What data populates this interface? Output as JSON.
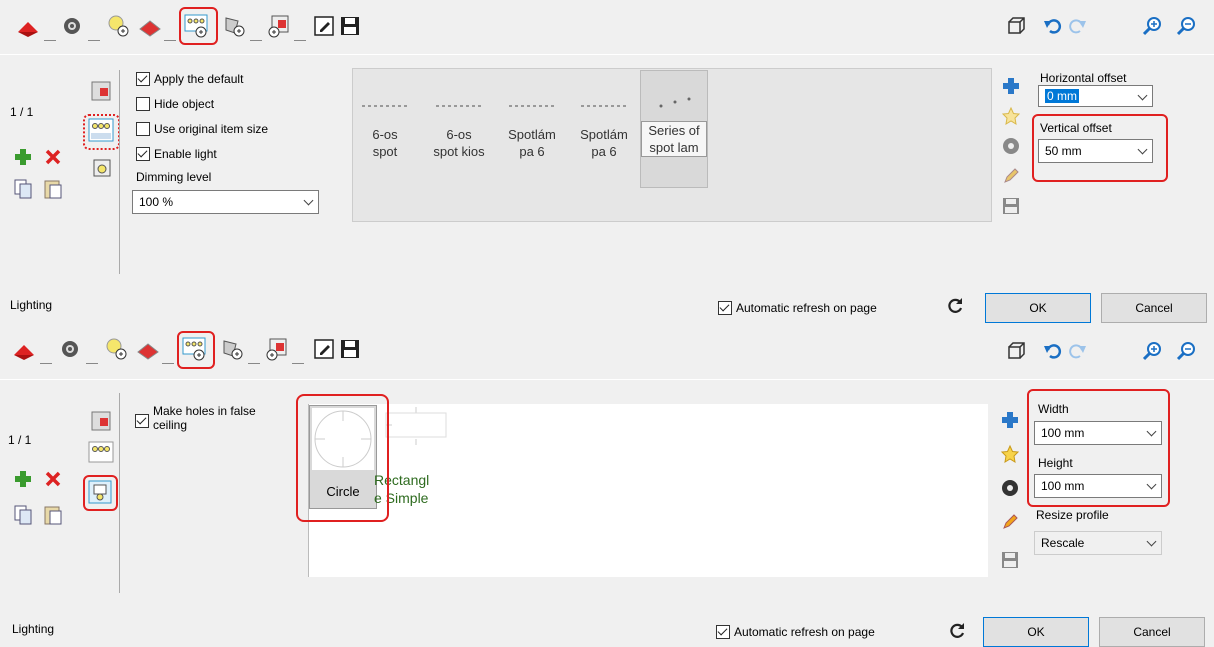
{
  "panel1": {
    "toolbar_icons": [
      "roof-icon",
      "gear-icon",
      "bulb-add-icon",
      "roof-shape-icon",
      "lights-add-icon",
      "lamp-add-icon",
      "block-add-icon",
      "edit-doc-icon",
      "save-icon"
    ],
    "counter": "1 / 1",
    "checkboxes": [
      {
        "label": "Apply the default",
        "checked": true
      },
      {
        "label": "Hide object",
        "checked": false
      },
      {
        "label": "Use original item size",
        "checked": false
      },
      {
        "label": "Enable light",
        "checked": true
      }
    ],
    "dimming_label": "Dimming level",
    "dimming_value": "100 %",
    "catalog": [
      {
        "line1": "6-os",
        "line2": "spot"
      },
      {
        "line1": "6-os",
        "line2": "spot kios"
      },
      {
        "line1": "Spotlám",
        "line2": "pa 6"
      },
      {
        "line1": "Spotlám",
        "line2": "pa 6"
      },
      {
        "line1": "Series of",
        "line2": "spot lam"
      }
    ],
    "horizontal_offset_label": "Horizontal offset",
    "horizontal_offset_value": "0 mm",
    "vertical_offset_label": "Vertical offset",
    "vertical_offset_value": "50 mm",
    "title": "Lighting",
    "auto_refresh_label": "Automatic refresh on page",
    "ok_label": "OK",
    "cancel_label": "Cancel"
  },
  "panel2": {
    "counter": "1 / 1",
    "make_holes_label": "Make holes in false ceiling",
    "circle_label": "Circle",
    "rect_line1": "Rectangl",
    "rect_line2": "e Simple",
    "width_label": "Width",
    "width_value": "100 mm",
    "height_label": "Height",
    "height_value": "100 mm",
    "resize_label": "Resize profile",
    "resize_value": "Rescale",
    "title": "Lighting",
    "auto_refresh_label": "Automatic refresh on page",
    "ok_label": "OK",
    "cancel_label": "Cancel"
  },
  "colors": {
    "highlight": "#e02020",
    "accent": "#0078d7",
    "catalog_bg": "#f0f0f0",
    "green": "#2e6b1f"
  }
}
